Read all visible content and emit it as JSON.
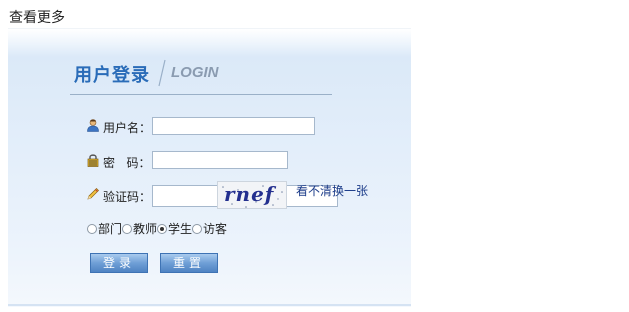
{
  "more_link": "查看更多",
  "login": {
    "title_cn": "用户登录",
    "title_en": "LOGIN",
    "username_label": "用户名：",
    "username_value": "",
    "password_label": "密   码：",
    "password_value": "",
    "captcha_label": "验证码：",
    "captcha_value": "",
    "captcha_image_text": "rnef",
    "refresh_captcha": "看不清换一张",
    "roles": [
      {
        "label": "部门",
        "checked": false
      },
      {
        "label": "教师",
        "checked": false
      },
      {
        "label": "学生",
        "checked": true
      },
      {
        "label": "访客",
        "checked": false
      }
    ],
    "login_button": "登录",
    "reset_button": "重置"
  },
  "icons": {
    "username": "user-icon",
    "password": "lock-icon",
    "captcha": "pencil-icon"
  },
  "colors": {
    "title_blue": "#2a6cb8",
    "button_blue": "#4f83c3",
    "link_blue": "#1d3d8a"
  }
}
